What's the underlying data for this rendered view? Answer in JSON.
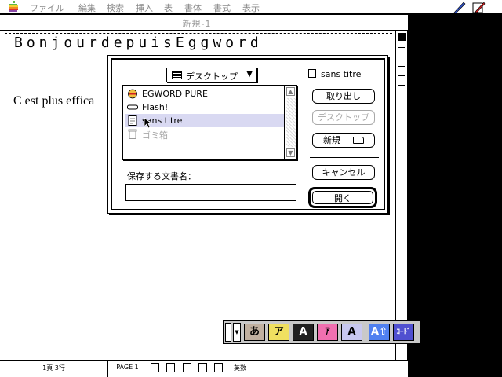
{
  "menubar": {
    "items": [
      "ファイル",
      "編集",
      "検索",
      "挿入",
      "表",
      "書体",
      "書式",
      "表示"
    ]
  },
  "window": {
    "title": "新規-1"
  },
  "document": {
    "heading": "BonjourdepuisEggword",
    "line2": "C est plus effica"
  },
  "dialog": {
    "location_popup": "デスクトップ",
    "volume_name": "sans titre",
    "files": [
      {
        "name": "EGWORD PURE",
        "icon": "app-icon",
        "state": "normal"
      },
      {
        "name": "Flash!",
        "icon": "disk-icon",
        "state": "normal"
      },
      {
        "name": "sans titre",
        "icon": "document-icon",
        "state": "selected"
      },
      {
        "name": "ゴミ箱",
        "icon": "trash-icon",
        "state": "disabled"
      }
    ],
    "buttons": {
      "eject": "取り出し",
      "desktop": "デスクトップ",
      "new_folder": "新規",
      "cancel": "キャンセル",
      "open": "開く"
    },
    "name_label": "保存する文書名：",
    "name_value": ""
  },
  "statusbar": {
    "position": "1頁 3行",
    "page": "PAGE 1",
    "mode": "英数"
  },
  "ime_palette": {
    "buttons": [
      {
        "label": "あ",
        "color": "#c0b0a0"
      },
      {
        "label": "ア",
        "color": "#f0e060"
      },
      {
        "label": "A",
        "color": "#202020"
      },
      {
        "label": "ｱ",
        "color": "#f070b0"
      },
      {
        "label": "A",
        "color": "#c8c8f0"
      },
      {
        "label": "A⇧",
        "color": "#5080f0"
      },
      {
        "label": "ｺｰﾄﾞ",
        "color": "#5050d0"
      }
    ]
  }
}
